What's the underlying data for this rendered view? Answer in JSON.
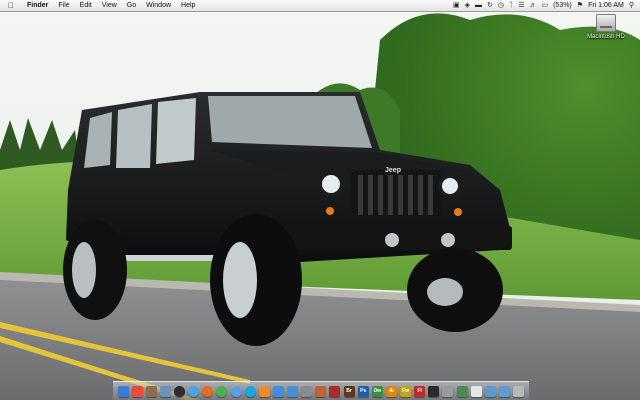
{
  "menubar": {
    "apple_icon": "apple-icon",
    "menus": [
      "Finder",
      "File",
      "Edit",
      "View",
      "Go",
      "Window",
      "Help"
    ],
    "battery_percent": "(53%)",
    "clock": "Fri 1:06 AM"
  },
  "desktop": {
    "icons": [
      {
        "label": "Macintosh HD",
        "icon": "hard-drive-icon"
      }
    ]
  },
  "wallpaper": {
    "grille_badge": "Jeep"
  },
  "dock": {
    "items": [
      {
        "name": "finder",
        "glyph": "",
        "color": "#3a7bd5",
        "round": false
      },
      {
        "name": "calendar",
        "glyph": "",
        "color": "#e84b3c",
        "round": false
      },
      {
        "name": "address-book",
        "glyph": "",
        "color": "#8b6f4e",
        "round": false
      },
      {
        "name": "mail",
        "glyph": "",
        "color": "#6d8fb8",
        "round": false
      },
      {
        "name": "dashboard",
        "glyph": "",
        "color": "#2c2c2c",
        "round": true
      },
      {
        "name": "safari",
        "glyph": "",
        "color": "#4aa3df",
        "round": true
      },
      {
        "name": "firefox",
        "glyph": "",
        "color": "#e66a1f",
        "round": true
      },
      {
        "name": "chrome",
        "glyph": "",
        "color": "#4caf50",
        "round": true
      },
      {
        "name": "itunes",
        "glyph": "",
        "color": "#5aa0e6",
        "round": true
      },
      {
        "name": "skype",
        "glyph": "",
        "color": "#19a7e0",
        "round": true
      },
      {
        "name": "vlc",
        "glyph": "",
        "color": "#f08a24",
        "round": false
      },
      {
        "name": "itunes-note",
        "glyph": "",
        "color": "#3f8de0",
        "round": false
      },
      {
        "name": "app-store",
        "glyph": "",
        "color": "#4a90d9",
        "round": false
      },
      {
        "name": "system-preferences",
        "glyph": "",
        "color": "#8a8a8a",
        "round": false
      },
      {
        "name": "garageband",
        "glyph": "",
        "color": "#c0642c",
        "round": false
      },
      {
        "name": "photo-booth",
        "glyph": "",
        "color": "#b02a2a",
        "round": false
      },
      {
        "name": "bridge",
        "glyph": "Br",
        "color": "#5b3a1a",
        "round": false
      },
      {
        "name": "photoshop",
        "glyph": "Ps",
        "color": "#1d5fa8",
        "round": false
      },
      {
        "name": "dreamweaver",
        "glyph": "Dw",
        "color": "#3e8e41",
        "round": false
      },
      {
        "name": "illustrator",
        "glyph": "Ai",
        "color": "#d9880f",
        "round": false
      },
      {
        "name": "fireworks",
        "glyph": "Fw",
        "color": "#c7a318",
        "round": false
      },
      {
        "name": "flash",
        "glyph": "Fl",
        "color": "#c0282d",
        "round": false
      },
      {
        "name": "terminal",
        "glyph": "",
        "color": "#2a2a2a",
        "round": false
      },
      {
        "name": "utility",
        "glyph": "",
        "color": "#9a9a9a",
        "round": false
      },
      {
        "name": "activity-monitor",
        "glyph": "",
        "color": "#4d8a4d",
        "round": false
      },
      {
        "name": "preview",
        "glyph": "",
        "color": "#e6e6e6",
        "round": false
      },
      {
        "name": "applications-folder",
        "glyph": "",
        "color": "#5b9bd5",
        "round": false
      },
      {
        "name": "documents-folder",
        "glyph": "",
        "color": "#5b9bd5",
        "round": false
      },
      {
        "name": "trash",
        "glyph": "",
        "color": "#b8b8b8",
        "round": false
      }
    ]
  }
}
